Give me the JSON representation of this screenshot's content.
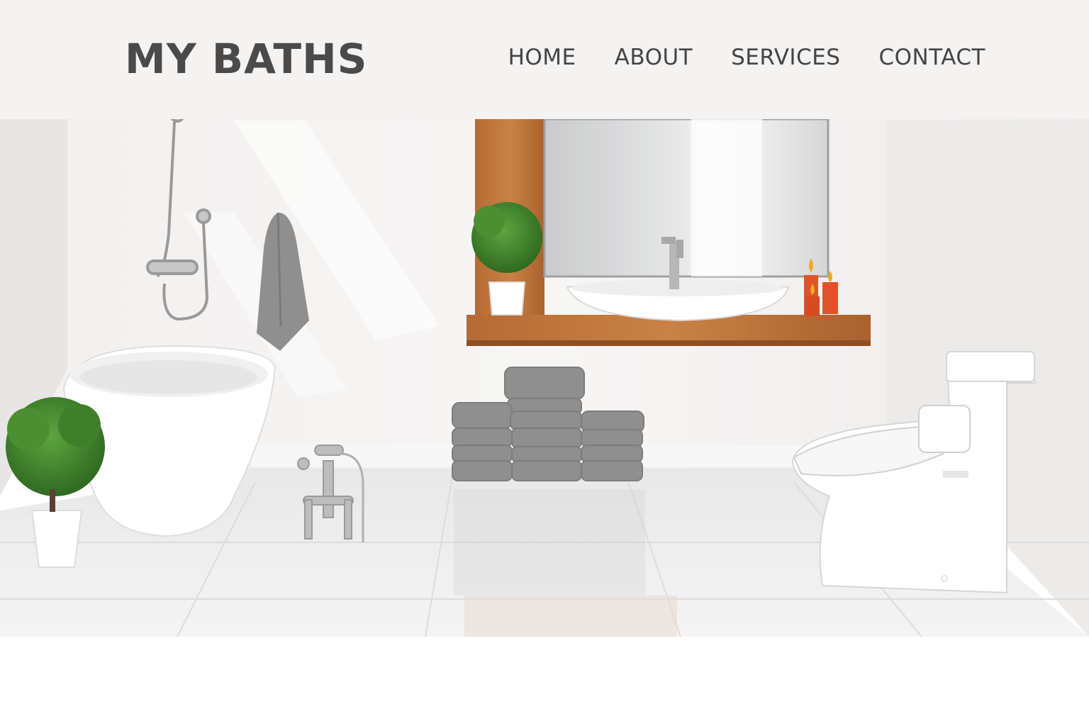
{
  "site": {
    "brand": "MY BATHS"
  },
  "nav": {
    "items": [
      {
        "label": "HOME"
      },
      {
        "label": "ABOUT"
      },
      {
        "label": "SERVICES"
      },
      {
        "label": "CONTACT"
      }
    ]
  },
  "colors": {
    "header_bg": "#f5f3f2",
    "brand_text": "#4a4a4a",
    "nav_text": "#444444",
    "wood": "#b8703a",
    "candle": "#e0522a",
    "towel": "#8f8f8f",
    "plant": "#3f7f2c"
  },
  "hero": {
    "icons": [
      "shower-icon",
      "towel-icon",
      "bathtub-icon",
      "plant-icon",
      "faucet-icon",
      "vanity-shelf-icon",
      "mirror-icon",
      "sink-icon",
      "candle-icon",
      "towel-stack-icon",
      "toilet-icon"
    ]
  }
}
